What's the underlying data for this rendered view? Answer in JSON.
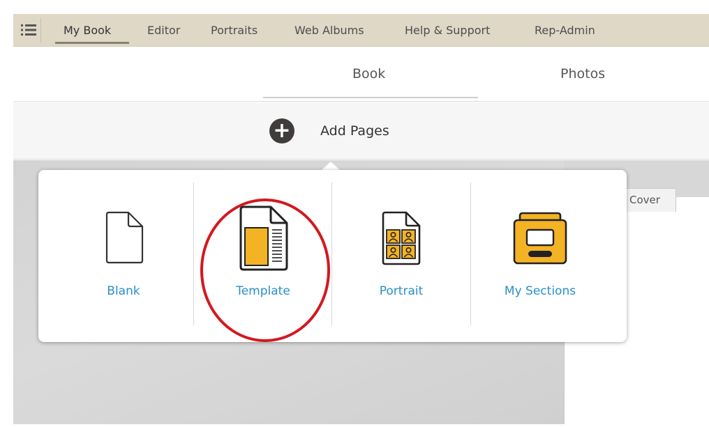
{
  "nav": {
    "items": [
      "My Book",
      "Editor",
      "Portraits",
      "Web Albums",
      "Help & Support",
      "Rep-Admin"
    ],
    "active": "My Book"
  },
  "tabs": {
    "items": [
      "Book",
      "Photos"
    ],
    "active": "Book"
  },
  "add_pages": {
    "label": "Add Pages"
  },
  "popover": {
    "options": [
      {
        "label": "Blank",
        "icon": "blank-page-icon"
      },
      {
        "label": "Template",
        "icon": "template-page-icon"
      },
      {
        "label": "Portrait",
        "icon": "portrait-page-icon"
      },
      {
        "label": "My Sections",
        "icon": "my-sections-icon"
      }
    ],
    "highlighted": "Template"
  },
  "workspace": {
    "cover_tab": "Cover"
  },
  "colors": {
    "nav_bg": "#dfd8c7",
    "accent_blue": "#2a8fc8",
    "icon_yellow": "#f4b324",
    "highlight_red": "#d3181f"
  }
}
